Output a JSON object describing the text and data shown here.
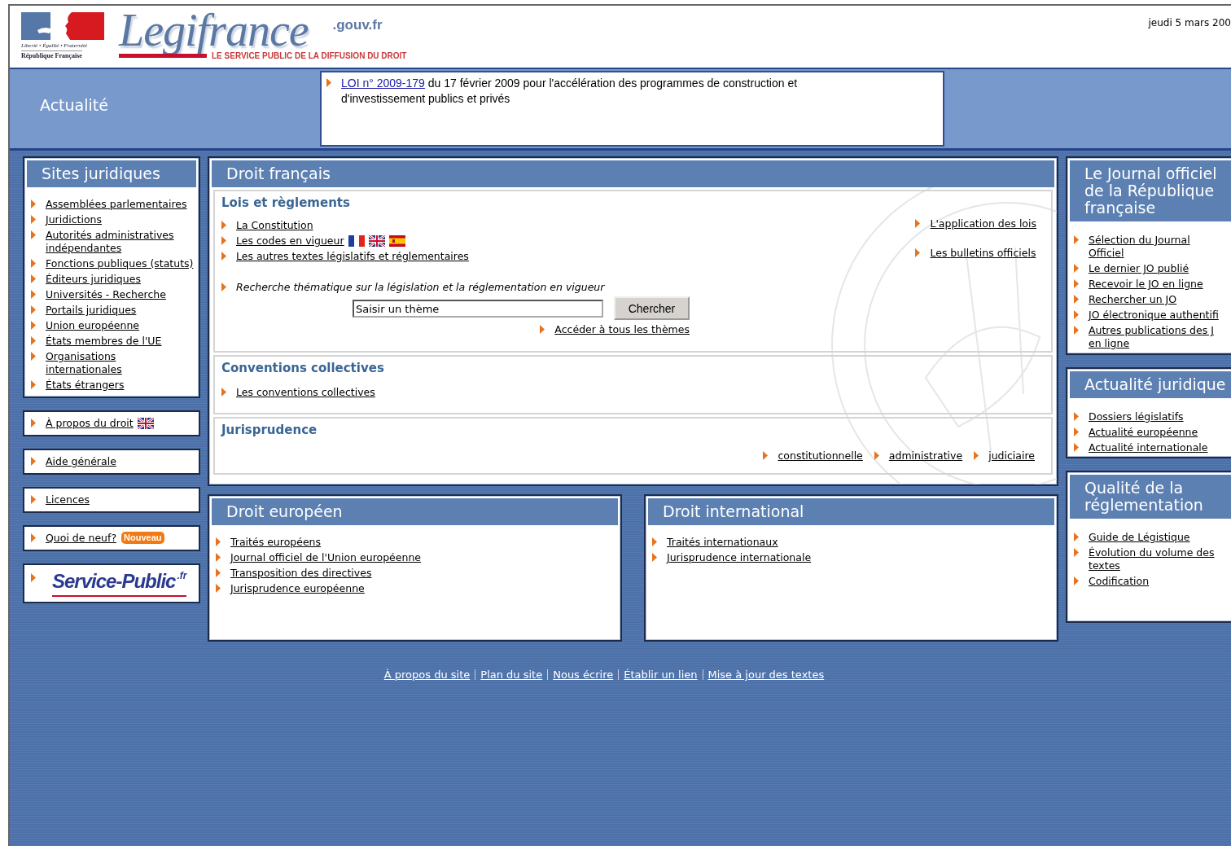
{
  "header": {
    "motto": "Liberté • Égalité • Fraternité",
    "country": "République Française",
    "site_name": "Legifrance",
    "domain": ".gouv.fr",
    "tagline": "LE SERVICE PUBLIC DE LA DIFFUSION DU DROIT",
    "date": "jeudi 5 mars 200"
  },
  "news": {
    "title": "Actualité",
    "items": [
      {
        "link": "LOI n° 2009-179",
        "text": " du 17 février 2009 pour l'accélération des programmes de construction et d'investissement publics et privés"
      }
    ]
  },
  "sites": {
    "title": "Sites juridiques",
    "links": [
      {
        "label": "Assemblées parlementaires"
      },
      {
        "label": "Juridictions"
      },
      {
        "label": "Autorités administratives indépendantes"
      },
      {
        "label": "Fonctions publiques (statuts)"
      },
      {
        "label": "Éditeurs juridiques"
      },
      {
        "label": "Universités - Recherche"
      },
      {
        "label": "Portails juridiques"
      },
      {
        "label": "Union européenne"
      },
      {
        "label": "États membres de l'UE"
      },
      {
        "label": "Organisations internationales"
      },
      {
        "label": "États étrangers"
      }
    ]
  },
  "left_boxes": [
    {
      "kind": "link",
      "label": "À propos du droit",
      "flags": [
        {
          "kind": "british"
        }
      ]
    },
    {
      "kind": "link",
      "label": "Aide générale"
    },
    {
      "kind": "link",
      "label": "Licences"
    },
    {
      "kind": "link",
      "label": "Quoi de neuf?",
      "badge": "Nouveau"
    },
    {
      "kind": "logo",
      "name": "Service-Public",
      "suffix": ".fr"
    }
  ],
  "droit_francais": {
    "title": "Droit français",
    "lois": {
      "title": "Lois et règlements",
      "left_links": [
        {
          "label": "La Constitution"
        },
        {
          "label": "Les codes en vigueur",
          "flags": [
            {
              "kind": "french"
            },
            {
              "kind": "british"
            },
            {
              "kind": "spanish"
            }
          ]
        },
        {
          "label": "Les autres textes législatifs et réglementaires"
        }
      ],
      "right_links": [
        {
          "label": "L'application des lois"
        },
        {
          "label": "Les bulletins officiels"
        }
      ],
      "search": {
        "label": "Recherche thématique sur la législation et la réglementation en vigueur",
        "value": "Saisir un thème",
        "button": "Chercher",
        "more": "Accéder à tous les thèmes"
      }
    },
    "conventions": {
      "title": "Conventions collectives",
      "links": [
        {
          "label": "Les conventions collectives"
        }
      ]
    },
    "jurisprudence": {
      "title": "Jurisprudence",
      "links": [
        {
          "label": "constitutionnelle"
        },
        {
          "label": "administrative"
        },
        {
          "label": "judiciaire"
        }
      ]
    }
  },
  "bottom_panels": [
    {
      "title": "Droit européen",
      "links": [
        {
          "label": "Traités européens"
        },
        {
          "label": "Journal officiel de l'Union européenne"
        },
        {
          "label": "Transposition des directives"
        },
        {
          "label": "Jurisprudence européenne"
        }
      ]
    },
    {
      "title": "Droit international",
      "links": [
        {
          "label": "Traités internationaux"
        },
        {
          "label": "Jurisprudence internationale"
        }
      ]
    }
  ],
  "right_panels": [
    {
      "title": "Le Journal officiel de la République française",
      "links": [
        {
          "label": [
            "Sélection du Journal",
            "Officiel"
          ]
        },
        {
          "label": "Le dernier JO publié"
        },
        {
          "label": "Recevoir le JO en ligne"
        },
        {
          "label": "Rechercher un JO"
        },
        {
          "label": "JO électronique authentifi"
        },
        {
          "label": [
            "Autres publications des J",
            "en ligne"
          ]
        }
      ]
    },
    {
      "title": "Actualité juridique",
      "links": [
        {
          "label": "Dossiers législatifs"
        },
        {
          "label": "Actualité européenne"
        },
        {
          "label": "Actualité internationale"
        }
      ]
    },
    {
      "title": "Qualité de la réglementation",
      "links": [
        {
          "label": "Guide de Légistique"
        },
        {
          "label": [
            "Évolution du volume des",
            "textes"
          ]
        },
        {
          "label": "Codification"
        }
      ]
    }
  ],
  "footer": {
    "links": [
      "À propos du site",
      "Plan du site",
      "Nous écrire",
      "Établir un lien",
      "Mise à jour des textes"
    ]
  }
}
